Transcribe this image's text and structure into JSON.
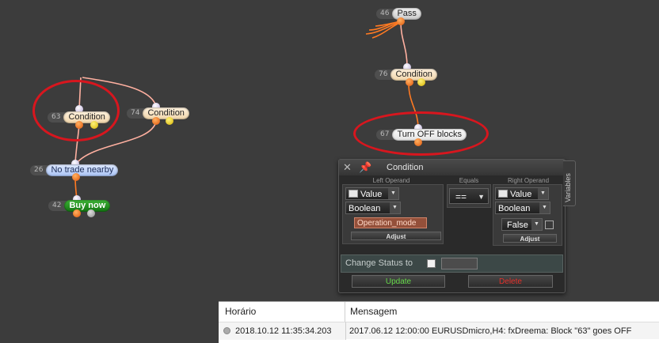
{
  "nodes": {
    "pass": {
      "id": "46",
      "label": "Pass"
    },
    "cond76": {
      "id": "76",
      "label": "Condition"
    },
    "turnoff": {
      "id": "67",
      "label": "Turn OFF blocks"
    },
    "cond63": {
      "id": "63",
      "label": "Condition"
    },
    "cond74": {
      "id": "74",
      "label": "Condition"
    },
    "notrade": {
      "id": "26",
      "label": "No trade nearby"
    },
    "buynow": {
      "id": "42",
      "label": "Buy now"
    }
  },
  "panel": {
    "title": "Condition",
    "left_operand_label": "Left Operand",
    "equals_label": "Equals",
    "right_operand_label": "Right Operand",
    "left_type": "Value",
    "left_datatype": "Boolean",
    "left_value": "Operation_mode",
    "adjust_label": "Adjust",
    "operator": "==",
    "right_type": "Value",
    "right_datatype": "Boolean",
    "right_value": "False",
    "change_status_label": "Change Status to",
    "update_label": "Update",
    "delete_label": "Delete",
    "variables_tab": "Variables"
  },
  "log": {
    "col_time": "Horário",
    "col_message": "Mensagem",
    "rows": [
      {
        "time": "2018.10.12 11:35:34.203",
        "message": "2017.06.12 12:00:00   EURUSDmicro,H4: fxDreema: Block \"63\" goes OFF"
      }
    ]
  },
  "colors": {
    "canvas": "#3c3c3c",
    "highlight_ring": "#d8161e",
    "link_orange": "#ff7a22",
    "link_pink": "#ffb0a0"
  }
}
